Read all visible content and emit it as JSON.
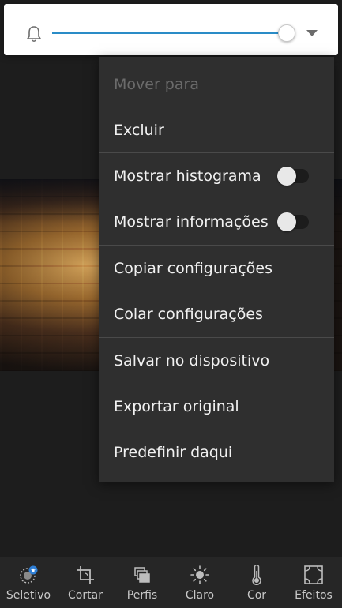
{
  "slider": {
    "value_fraction": 0.99,
    "icons": {
      "left": "bell-icon",
      "right": "chevron-down-icon"
    },
    "accent_color": "#2a8cc7"
  },
  "menu": {
    "items": [
      {
        "label": "Mover para",
        "enabled": false
      },
      {
        "label": "Excluir",
        "enabled": true
      },
      {
        "label": "Mostrar histograma",
        "toggle": false
      },
      {
        "label": "Mostrar informações",
        "toggle": false
      },
      {
        "label": "Copiar configurações",
        "enabled": true
      },
      {
        "label": "Colar configurações",
        "enabled": true
      },
      {
        "label": "Salvar no dispositivo",
        "enabled": true
      },
      {
        "label": "Exportar original",
        "enabled": true
      },
      {
        "label": "Predefinir daqui",
        "enabled": true
      }
    ]
  },
  "toolbar": {
    "tools": [
      {
        "label": "Seletivo",
        "icon": "selective-icon"
      },
      {
        "label": "Cortar",
        "icon": "crop-icon"
      },
      {
        "label": "Perfis",
        "icon": "profiles-icon"
      },
      {
        "label": "Claro",
        "icon": "sun-icon"
      },
      {
        "label": "Cor",
        "icon": "thermometer-icon"
      },
      {
        "label": "Efeitos",
        "icon": "effects-icon"
      }
    ],
    "badge_color": "#2f7fd6"
  }
}
